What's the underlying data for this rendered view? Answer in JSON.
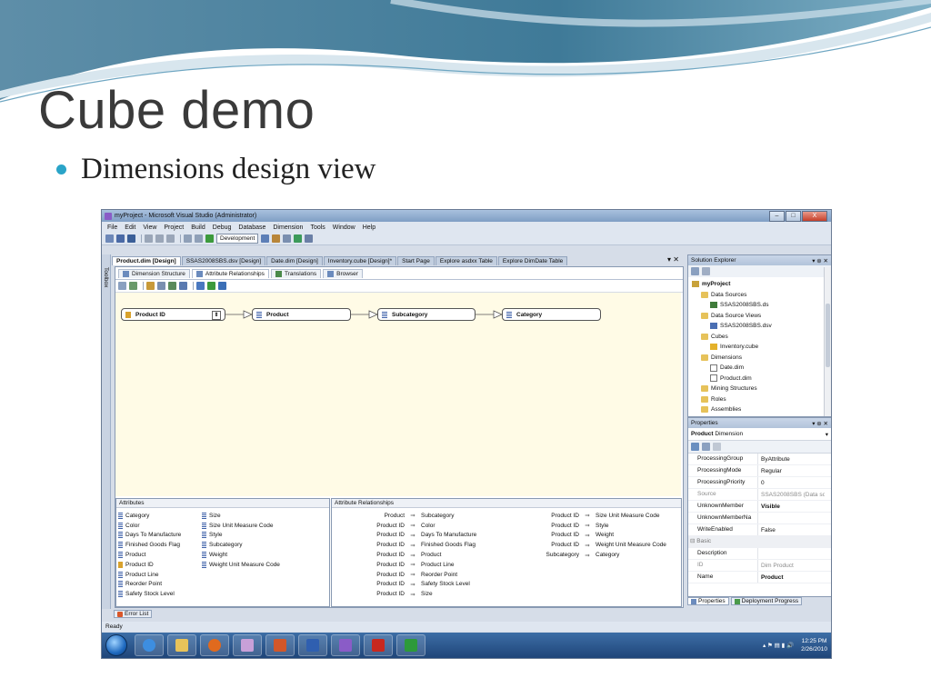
{
  "slide": {
    "title": "Cube demo",
    "bullet": "Dimensions design view"
  },
  "window": {
    "title": "myProject - Microsoft Visual Studio (Administrator)",
    "buttons": [
      "–",
      "□",
      "X"
    ]
  },
  "menu": [
    "File",
    "Edit",
    "View",
    "Project",
    "Build",
    "Debug",
    "Database",
    "Dimension",
    "Tools",
    "Window",
    "Help"
  ],
  "toolbar": {
    "config": "Development"
  },
  "toolbox_label": "Toolbox",
  "doc_tabs": [
    "Product.dim [Design]",
    "SSAS2008SBS.dsv [Design]",
    "Date.dim [Design]",
    "Inventory.cube [Design]*",
    "Start Page",
    "Explore asdxx Table",
    "Explore DimDate Table"
  ],
  "designer_tabs": [
    "Dimension Structure",
    "Attribute Relationships",
    "Translations",
    "Browser"
  ],
  "relationship_nodes": [
    "Product ID",
    "Product",
    "Subcategory",
    "Category"
  ],
  "attributes": {
    "header": "Attributes",
    "col1": [
      "Category",
      "Color",
      "Days To Manufacture",
      "Finished Goods Flag",
      "Product",
      "Product ID",
      "Product Line",
      "Reorder Point",
      "Safety Stock Level"
    ],
    "col2": [
      "Size",
      "Size Unit Measure Code",
      "Style",
      "Subcategory",
      "Weight",
      "Weight Unit Measure Code"
    ]
  },
  "relationships": {
    "header": "Attribute Relationships",
    "col1": [
      {
        "from": "Product",
        "to": "Subcategory"
      },
      {
        "from": "Product ID",
        "to": "Color"
      },
      {
        "from": "Product ID",
        "to": "Days To Manufacture"
      },
      {
        "from": "Product ID",
        "to": "Finished Goods Flag"
      },
      {
        "from": "Product ID",
        "to": "Product"
      },
      {
        "from": "Product ID",
        "to": "Product Line"
      },
      {
        "from": "Product ID",
        "to": "Reorder Point"
      },
      {
        "from": "Product ID",
        "to": "Safety Stock Level"
      },
      {
        "from": "Product ID",
        "to": "Size"
      }
    ],
    "col2": [
      {
        "from": "Product ID",
        "to": "Size Unit Measure Code"
      },
      {
        "from": "Product ID",
        "to": "Style"
      },
      {
        "from": "Product ID",
        "to": "Weight"
      },
      {
        "from": "Product ID",
        "to": "Weight Unit Measure Code"
      },
      {
        "from": "Subcategory",
        "to": "Category"
      }
    ]
  },
  "error_list": "Error List",
  "solution_explorer": {
    "title": "Solution Explorer",
    "items": [
      {
        "label": "myProject",
        "icon": "project-icon",
        "level": 0,
        "bold": true
      },
      {
        "label": "Data Sources",
        "icon": "folder-icon",
        "level": 1
      },
      {
        "label": "SSAS2008SBS.ds",
        "icon": "datasource-icon",
        "level": 2
      },
      {
        "label": "Data Source Views",
        "icon": "folder-icon",
        "level": 1
      },
      {
        "label": "SSAS2008SBS.dsv",
        "icon": "dsv-icon",
        "level": 2
      },
      {
        "label": "Cubes",
        "icon": "folder-icon",
        "level": 1
      },
      {
        "label": "Inventory.cube",
        "icon": "cube-icon",
        "level": 2
      },
      {
        "label": "Dimensions",
        "icon": "folder-icon",
        "level": 1
      },
      {
        "label": "Date.dim",
        "icon": "dimension-icon",
        "level": 2
      },
      {
        "label": "Product.dim",
        "icon": "dimension-icon",
        "level": 2
      },
      {
        "label": "Mining Structures",
        "icon": "folder-icon",
        "level": 1
      },
      {
        "label": "Roles",
        "icon": "folder-icon",
        "level": 1
      },
      {
        "label": "Assemblies",
        "icon": "folder-icon",
        "level": 1
      }
    ]
  },
  "properties": {
    "title": "Properties",
    "selected_name": "Product",
    "selected_type": "Dimension",
    "rows": [
      {
        "name": "ProcessingGroup",
        "value": "ByAttribute"
      },
      {
        "name": "ProcessingMode",
        "value": "Regular"
      },
      {
        "name": "ProcessingPriority",
        "value": "0"
      },
      {
        "name": "Source",
        "value": "SSAS2008SBS (Data so",
        "grey": true
      },
      {
        "name": "UnknownMember",
        "value": "Visible",
        "bold": true
      },
      {
        "name": "UnknownMemberNa",
        "value": ""
      },
      {
        "name": "WriteEnabled",
        "value": "False"
      },
      {
        "name": "Basic",
        "value": "",
        "category": true
      },
      {
        "name": "Description",
        "value": ""
      },
      {
        "name": "ID",
        "value": "Dim Product",
        "grey": true
      },
      {
        "name": "Name",
        "value": "Product",
        "bold": true
      }
    ],
    "footer_tabs": [
      "Properties",
      "Deployment Progress"
    ]
  },
  "status": "Ready",
  "clock": {
    "time": "12:25 PM",
    "date": "2/26/2010"
  },
  "colors": {
    "accent": "#2aa4c8",
    "canvas": "#fffbe6",
    "taskbar": "#1f4579"
  }
}
